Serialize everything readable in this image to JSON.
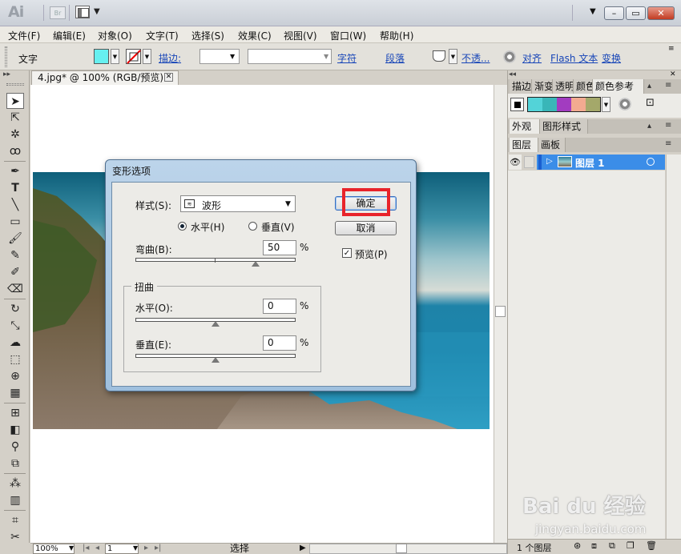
{
  "app": {
    "logo": "Ai",
    "bridge_badge": "Br",
    "window_controls": [
      "–",
      "▭",
      "✕"
    ]
  },
  "menubar": [
    "文件(F)",
    "编辑(E)",
    "对象(O)",
    "文字(T)",
    "选择(S)",
    "效果(C)",
    "视图(V)",
    "窗口(W)",
    "帮助(H)"
  ],
  "controlbar": {
    "context_label": "文字",
    "fill_color": "#66f0f0",
    "stroke_label": "描边:",
    "links": [
      "字符",
      "段落",
      "不透...",
      "对齐",
      "Flash 文本",
      "变换"
    ]
  },
  "document": {
    "tab_title": "4.jpg* @ 100% (RGB/预览)",
    "tab_close": "✕"
  },
  "statusbar": {
    "zoom": "100%",
    "page": "1",
    "tool_status": "选择"
  },
  "panels": {
    "top_tabs": [
      "描边",
      "渐变",
      "透明",
      "颜色",
      "颜色参考"
    ],
    "mid_tabs": [
      "外观",
      "图形样式"
    ],
    "layer_tabs": [
      "图层",
      "画板"
    ],
    "guide_colors": [
      "#53d3d8",
      "#39b6b8",
      "#a23cc0",
      "#f2aa90",
      "#a4a86a"
    ],
    "layer_name": "图层 1",
    "layers_count": "1 个图层"
  },
  "dialog": {
    "title": "变形选项",
    "style_label": "样式(S):",
    "style_value": "波形",
    "horizontal_radio": "水平(H)",
    "vertical_radio": "垂直(V)",
    "bend_label": "弯曲(B):",
    "bend_value": "50",
    "percent": "%",
    "distortion_group": "扭曲",
    "dist_h_label": "水平(O):",
    "dist_h_value": "0",
    "dist_v_label": "垂直(E):",
    "dist_v_value": "0",
    "ok_button": "确定",
    "cancel_button": "取消",
    "preview_label": "预览(P)",
    "bend_fraction": 0.75,
    "dist_h_fraction": 0.5,
    "dist_v_fraction": 0.5
  },
  "watermark": {
    "brand": "Bai du 经验",
    "url": "jingyan.baidu.com"
  }
}
